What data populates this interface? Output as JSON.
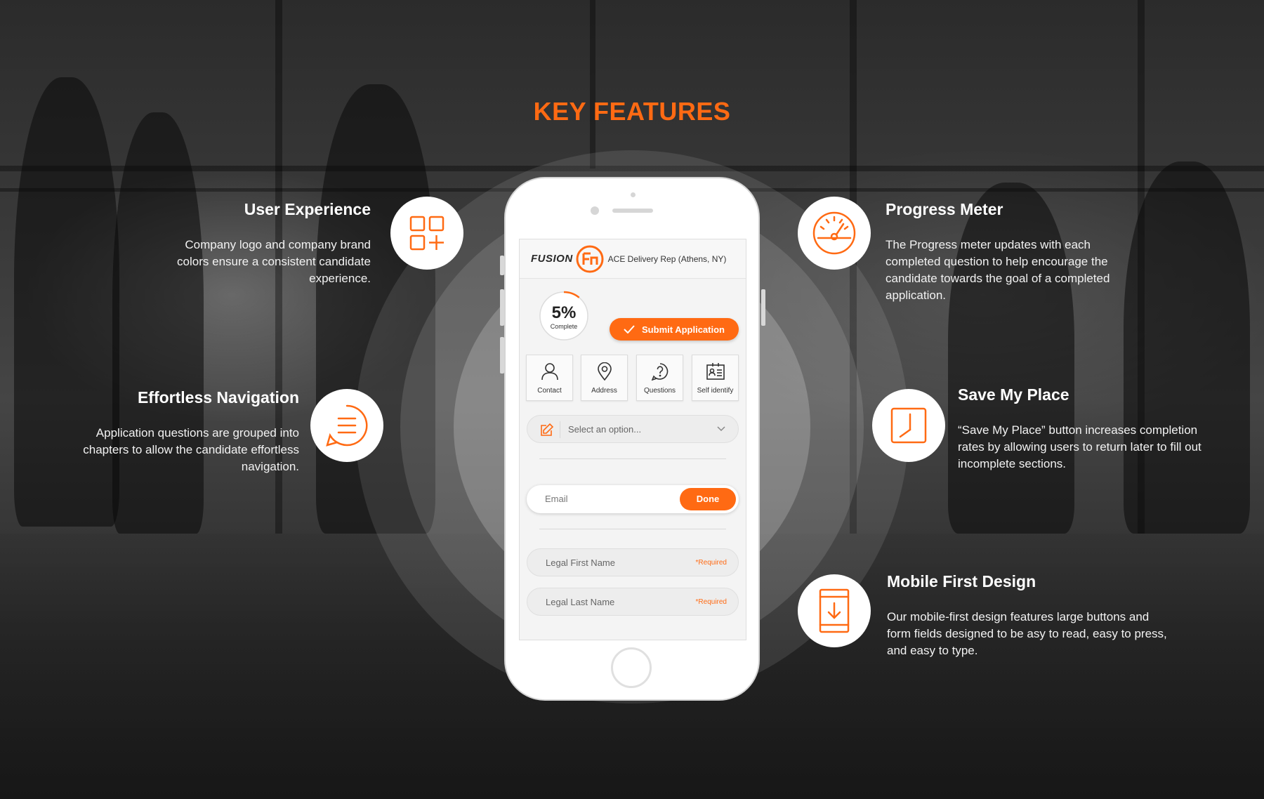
{
  "title": "KEY FEATURES",
  "colors": {
    "accent": "#ff6a13",
    "text": "#ffffff",
    "card": "#ffffff"
  },
  "features": [
    {
      "title": "User Experience",
      "desc": "Company logo and company brand colors ensure a consistent candidate experience.",
      "icon": "apps-add-icon"
    },
    {
      "title": "Effortless Navigation",
      "desc": "Application questions are grouped into chapters to allow the candidate effortless navigation.",
      "icon": "list-icon"
    },
    {
      "title": "Progress Meter",
      "desc": "The Progress meter updates with each completed question to help encourage the candidate towards the goal of a completed application.",
      "icon": "speedometer-icon"
    },
    {
      "title": "Save My Place",
      "desc": "“Save My Place” button increases completion rates by allowing users to return later to fill out incomplete sections.",
      "icon": "clock-icon"
    },
    {
      "title": "Mobile First Design",
      "desc": "Our mobile-first design features large buttons and form fields designed to be asy to read, easy to press, and easy to type.",
      "icon": "mobile-download-icon"
    }
  ],
  "app": {
    "brand": "FUSION",
    "job_title": "ACE Delivery Rep (Athens, NY)",
    "progress": {
      "value": "5%",
      "label": "Complete",
      "fraction": 0.05
    },
    "submit_label": "Submit Application",
    "tabs": [
      {
        "label": "Contact",
        "icon": "person-icon"
      },
      {
        "label": "Address",
        "icon": "map-pin-icon"
      },
      {
        "label": "Questions",
        "icon": "question-icon"
      },
      {
        "label": "Self identify",
        "icon": "id-card-icon"
      }
    ],
    "select_placeholder": "Select an option...",
    "email_placeholder": "Email",
    "done_label": "Done",
    "fields": [
      {
        "placeholder": "Legal First Name",
        "required": "*Required"
      },
      {
        "placeholder": "Legal Last Name",
        "required": "*Required"
      }
    ]
  }
}
